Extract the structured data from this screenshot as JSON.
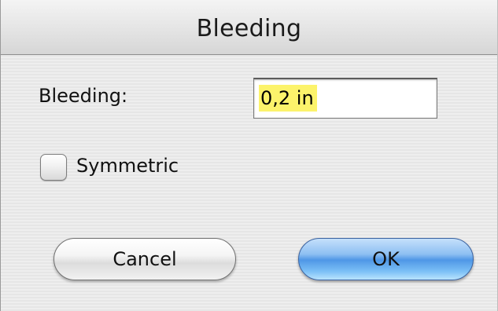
{
  "window": {
    "title": "Bleeding"
  },
  "form": {
    "bleeding_label": "Bleeding:",
    "bleeding_value": "0,2 in",
    "symmetric_label": "Symmetric",
    "symmetric_checked": false
  },
  "buttons": {
    "cancel_label": "Cancel",
    "ok_label": "OK"
  },
  "colors": {
    "selection_highlight": "#fcf36b",
    "default_button": "#4f97e6"
  }
}
